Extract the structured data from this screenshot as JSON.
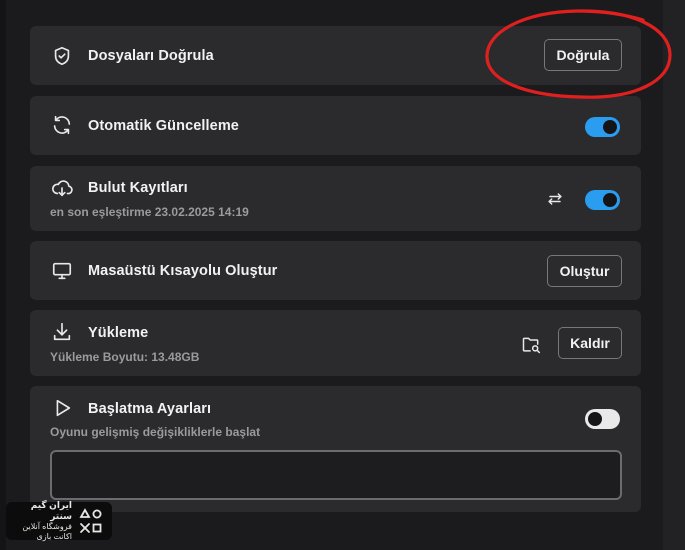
{
  "rows": {
    "verify": {
      "title": "Dosyaları Doğrula",
      "button": "Doğrula",
      "icon": "shield-check-icon"
    },
    "auto_update": {
      "title": "Otomatik Güncelleme",
      "toggle_on": true,
      "icon": "refresh-icon"
    },
    "cloud_saves": {
      "title": "Bulut Kayıtları",
      "subtitle": "en son eşleştirme 23.02.2025 14:19",
      "toggle_on": true,
      "icon": "cloud-download-icon",
      "sync_icon": "sync-arrows-icon"
    },
    "desktop_shortcut": {
      "title": "Masaüstü Kısayolu Oluştur",
      "button": "Oluştur",
      "icon": "monitor-icon"
    },
    "install": {
      "title": "Yükleme",
      "subtitle": "Yükleme Boyutu: 13.48GB",
      "button": "Kaldır",
      "icon": "download-icon",
      "folder_icon": "folder-search-icon"
    },
    "launch_options": {
      "title": "Başlatma Ayarları",
      "subtitle": "Oyunu gelişmiş değişikliklerle başlat",
      "toggle_on": false,
      "icon": "play-icon",
      "input_value": ""
    }
  },
  "watermark": {
    "line1": "ایران گیم سنتر",
    "line2": "فروشگاه آنلاین اکانت بازی"
  },
  "colors": {
    "accent": "#2b9df0",
    "annotation": "#e0201f",
    "row_bg": "#2b2b2e"
  }
}
